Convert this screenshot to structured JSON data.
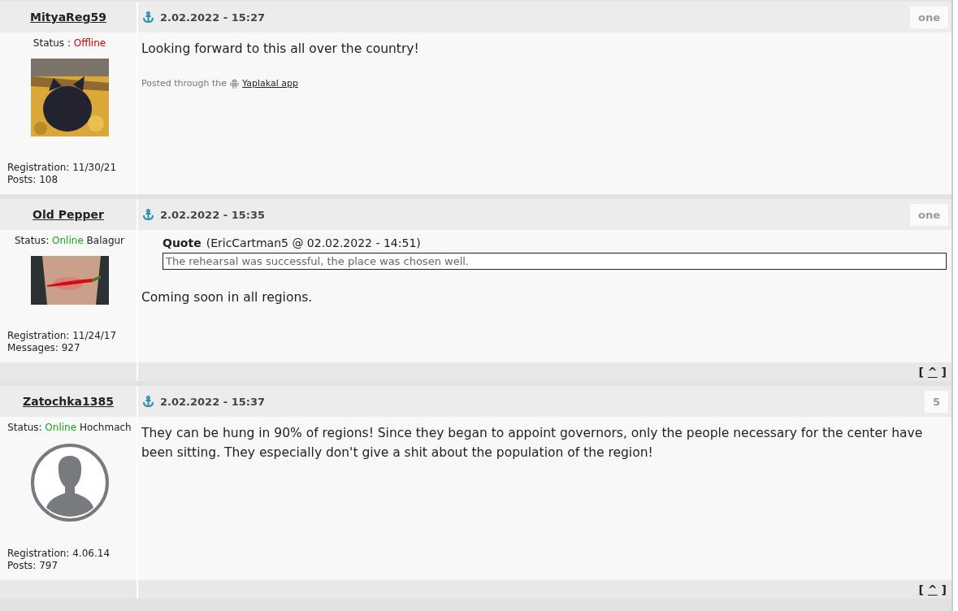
{
  "posts": [
    {
      "author": "MityaReg59",
      "date": "2.02.2022 - 15:27",
      "number": "one",
      "status": {
        "label": "Status :",
        "value": "Offline",
        "online": false
      },
      "avatar": {
        "kind": "picture"
      },
      "stats": [
        "Registration: 11/30/21",
        "Posts: 108"
      ],
      "text": "Looking forward to this all over the country!",
      "signature": {
        "prefix": "Posted through the",
        "link": "Yaplakal app"
      }
    },
    {
      "author": "Old Pepper",
      "date": "2.02.2022 - 15:35",
      "number": "one",
      "status": {
        "label": "Status:",
        "value": "Online",
        "online": true,
        "rank": "Balagur"
      },
      "avatar": {
        "kind": "picture"
      },
      "stats": [
        "Registration: 11/24/17",
        "Messages: 927"
      ],
      "quote": {
        "title": "Quote",
        "source": "(EricCartman5 @ 02.02.2022 - 14:51)",
        "text": "The rehearsal was successful, the place was chosen well."
      },
      "text": "Coming soon in all regions.",
      "footer": {
        "open": "[",
        "link": "^",
        "close": "]"
      }
    },
    {
      "author": "Zatochka1385",
      "date": "2.02.2022 - 15:37",
      "number": "5",
      "status": {
        "label": "Status:",
        "value": "Online",
        "online": true,
        "rank": "Hochmach"
      },
      "avatar": {
        "kind": "silhouette"
      },
      "stats": [
        "Registration: 4.06.14",
        "Posts: 797"
      ],
      "text": "They can be hung in 90% of regions! Since they began to appoint governors, only the people necessary for the center have been sitting. They especially don't give a shit about the population of the region!",
      "footer": {
        "open": "[",
        "link": "^",
        "close": "]"
      }
    }
  ]
}
